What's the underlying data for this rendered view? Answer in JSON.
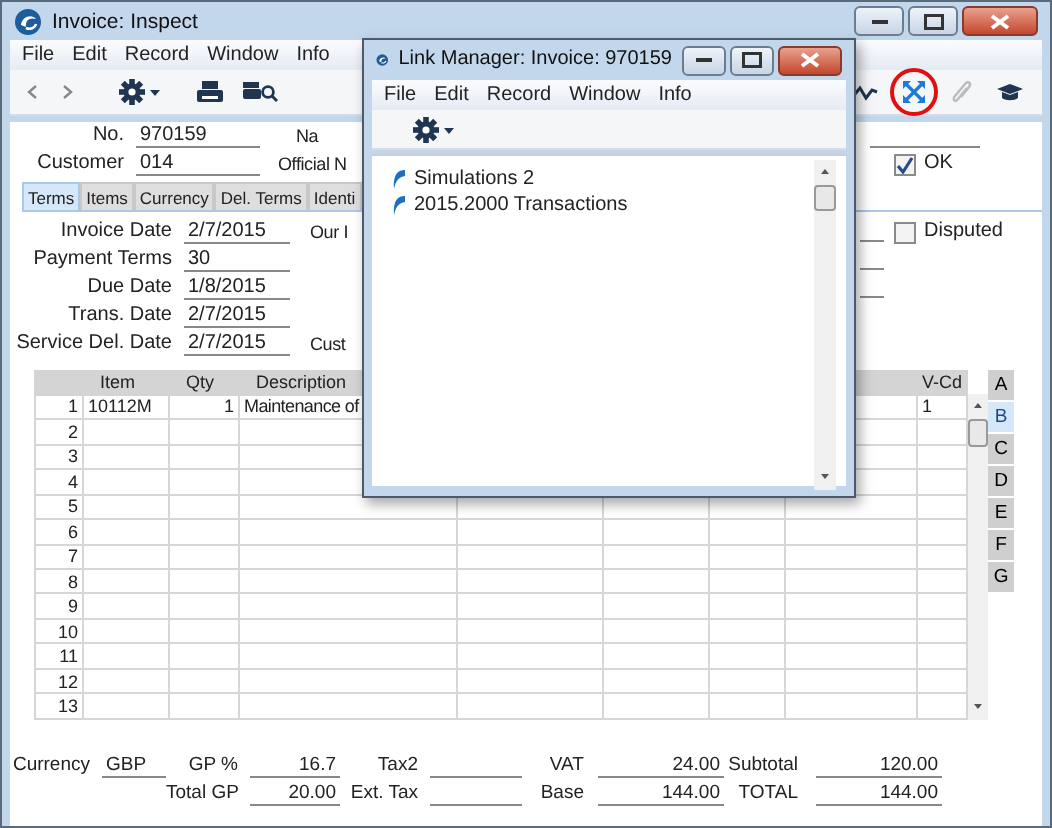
{
  "main_window": {
    "title": "Invoice: Inspect",
    "menu": [
      "File",
      "Edit",
      "Record",
      "Window",
      "Info"
    ]
  },
  "tool_buttons": [
    {
      "highlighted": false,
      "disabled": false
    },
    {
      "highlighted": true,
      "disabled": false
    },
    {
      "highlighted": false,
      "disabled": true
    },
    {
      "highlighted": false,
      "disabled": false
    }
  ],
  "header": {
    "fields": [
      {
        "label": "No.",
        "value": "970159"
      },
      {
        "label": "Customer",
        "value": "014"
      }
    ],
    "cut_labels": [
      "Na",
      "Official N"
    ],
    "ok": {
      "label": "OK",
      "checked": true
    }
  },
  "tabs": [
    {
      "label": "Terms",
      "selected": true
    },
    {
      "label": "Items",
      "selected": false
    },
    {
      "label": "Currency",
      "selected": false
    },
    {
      "label": "Del. Terms",
      "selected": false
    },
    {
      "label": "Identi",
      "selected": false
    }
  ],
  "terms": {
    "fields": [
      {
        "label": "Invoice Date",
        "value": "2/7/2015"
      },
      {
        "label": "Payment Terms",
        "value": "30"
      },
      {
        "label": "Due Date",
        "value": "1/8/2015"
      },
      {
        "label": "Trans. Date",
        "value": "2/7/2015"
      },
      {
        "label": "Service Del. Date",
        "value": "2/7/2015"
      }
    ],
    "cut_labels": [
      "Our I",
      "Cust"
    ],
    "disputed": {
      "label": "Disputed",
      "checked": false
    }
  },
  "grid": {
    "columns": [
      "Item",
      "Qty",
      "Description"
    ],
    "last_column": "V-Cd",
    "rows": [
      {
        "number": "1",
        "item": "10112M",
        "qty": "1",
        "description": "Maintenance of",
        "v_cd": "1"
      },
      {
        "number": "2"
      },
      {
        "number": "3"
      },
      {
        "number": "4"
      },
      {
        "number": "5"
      },
      {
        "number": "6"
      },
      {
        "number": "7"
      },
      {
        "number": "8"
      },
      {
        "number": "9"
      },
      {
        "number": "10"
      },
      {
        "number": "11"
      },
      {
        "number": "12"
      },
      {
        "number": "13"
      }
    ],
    "side_tabs": [
      {
        "label": "A",
        "selected": false
      },
      {
        "label": "B",
        "selected": true
      },
      {
        "label": "C",
        "selected": false
      },
      {
        "label": "D",
        "selected": false
      },
      {
        "label": "E",
        "selected": false
      },
      {
        "label": "F",
        "selected": false
      },
      {
        "label": "G",
        "selected": false
      }
    ]
  },
  "footer": [
    [
      {
        "label": "Currency",
        "value": "GBP"
      },
      {
        "label": "GP %",
        "value": "16.7"
      },
      {
        "label": "Tax2"
      },
      {
        "label": "VAT",
        "value": "24.00"
      },
      {
        "label": "Subtotal",
        "value": "120.00"
      }
    ],
    [
      {
        "label": "Total GP",
        "value": "20.00"
      },
      {
        "label": "Ext. Tax"
      },
      {
        "label": "Base",
        "value": "144.00"
      },
      {
        "label": "TOTAL",
        "value": "144.00"
      }
    ]
  ],
  "link_manager": {
    "title": "Link Manager: Invoice: 970159",
    "menu": [
      "File",
      "Edit",
      "Record",
      "Window",
      "Info"
    ],
    "items": [
      "Simulations 2",
      "2015.2000 Transactions"
    ]
  }
}
